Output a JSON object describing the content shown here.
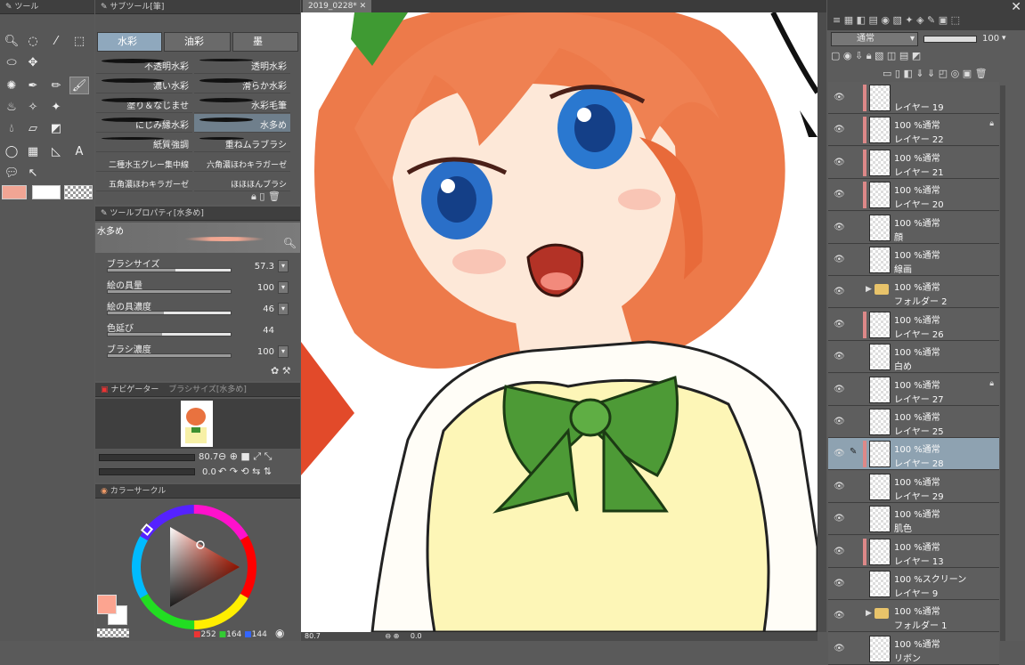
{
  "canvas_tab": "2019_0228*",
  "tool_panel": {
    "title": "ツール"
  },
  "subtool_panel": {
    "title": "サブツール[筆]",
    "tabs": [
      {
        "label": "水彩"
      },
      {
        "label": "油彩"
      },
      {
        "label": "墨"
      }
    ],
    "brushes": [
      {
        "label": "不透明水彩"
      },
      {
        "label": "透明水彩"
      },
      {
        "label": "濃い水彩"
      },
      {
        "label": "滑らか水彩"
      },
      {
        "label": "塗り＆なじませ"
      },
      {
        "label": "水彩毛筆"
      },
      {
        "label": "にじみ縁水彩"
      },
      {
        "label": "水多め"
      },
      {
        "label": "紙質強調"
      },
      {
        "label": "重ねムラブラシ"
      },
      {
        "label": "二種水玉グレー集中線"
      },
      {
        "label": "六角濃ほわキラガーゼ"
      },
      {
        "label": "五角濃ほわキラガーゼ"
      },
      {
        "label": "ほほほんブラシ"
      }
    ]
  },
  "tool_property": {
    "title": "ツールプロパティ[水多め]",
    "preset": "水多め",
    "params": [
      {
        "label": "ブラシサイズ",
        "value": "57.3",
        "level": 0.55
      },
      {
        "label": "絵の具量",
        "value": "100",
        "level": 1.0
      },
      {
        "label": "絵の具濃度",
        "value": "46",
        "level": 0.46
      },
      {
        "label": "色延び",
        "value": "44",
        "level": 0.44
      },
      {
        "label": "ブラシ濃度",
        "value": "100",
        "level": 1.0
      }
    ]
  },
  "navigator": {
    "tab1": "ナビゲーター",
    "tab2": "ブラシサイズ[水多め]",
    "zoom": "80.7",
    "rotate": "0.0"
  },
  "color_panel": {
    "title": "カラーサークル",
    "r": "252",
    "g": "164",
    "b": "144",
    "main_color": "#fca490"
  },
  "layer_panel": {
    "blend_mode": "通常",
    "opacity": "100",
    "layers": [
      {
        "mode": "",
        "name": "レイヤー 19",
        "lock": false,
        "mark": true,
        "folder": false
      },
      {
        "mode": "100 %通常",
        "name": "レイヤー 22",
        "lock": true,
        "mark": true,
        "folder": false
      },
      {
        "mode": "100 %通常",
        "name": "レイヤー 21",
        "lock": false,
        "mark": true,
        "folder": false
      },
      {
        "mode": "100 %通常",
        "name": "レイヤー 20",
        "lock": false,
        "mark": true,
        "folder": false
      },
      {
        "mode": "100 %通常",
        "name": "顔",
        "lock": false,
        "mark": false,
        "folder": false
      },
      {
        "mode": "100 %通常",
        "name": "線画",
        "lock": false,
        "mark": false,
        "folder": false
      },
      {
        "mode": "100 %通常",
        "name": "フォルダー 2",
        "lock": false,
        "mark": false,
        "folder": true
      },
      {
        "mode": "100 %通常",
        "name": "レイヤー 26",
        "lock": false,
        "mark": true,
        "folder": false
      },
      {
        "mode": "100 %通常",
        "name": "白め",
        "lock": false,
        "mark": false,
        "folder": false
      },
      {
        "mode": "100 %通常",
        "name": "レイヤー 27",
        "lock": true,
        "mark": false,
        "folder": false
      },
      {
        "mode": "100 %通常",
        "name": "レイヤー 25",
        "lock": false,
        "mark": false,
        "folder": false
      },
      {
        "mode": "100 %通常",
        "name": "レイヤー 28",
        "lock": false,
        "mark": true,
        "folder": false,
        "selected": true
      },
      {
        "mode": "100 %通常",
        "name": "レイヤー 29",
        "lock": false,
        "mark": false,
        "folder": false
      },
      {
        "mode": "100 %通常",
        "name": "肌色",
        "lock": false,
        "mark": false,
        "folder": false
      },
      {
        "mode": "100 %通常",
        "name": "レイヤー 13",
        "lock": false,
        "mark": true,
        "folder": false
      },
      {
        "mode": "100 %スクリーン",
        "name": "レイヤー 9",
        "lock": false,
        "mark": false,
        "folder": false
      },
      {
        "mode": "100 %通常",
        "name": "フォルダー 1",
        "lock": false,
        "mark": false,
        "folder": true
      },
      {
        "mode": "100 %通常",
        "name": "リボン",
        "lock": false,
        "mark": false,
        "folder": false
      }
    ]
  },
  "status_bar": {
    "zoom": "80.7",
    "rotate": "0.0"
  }
}
